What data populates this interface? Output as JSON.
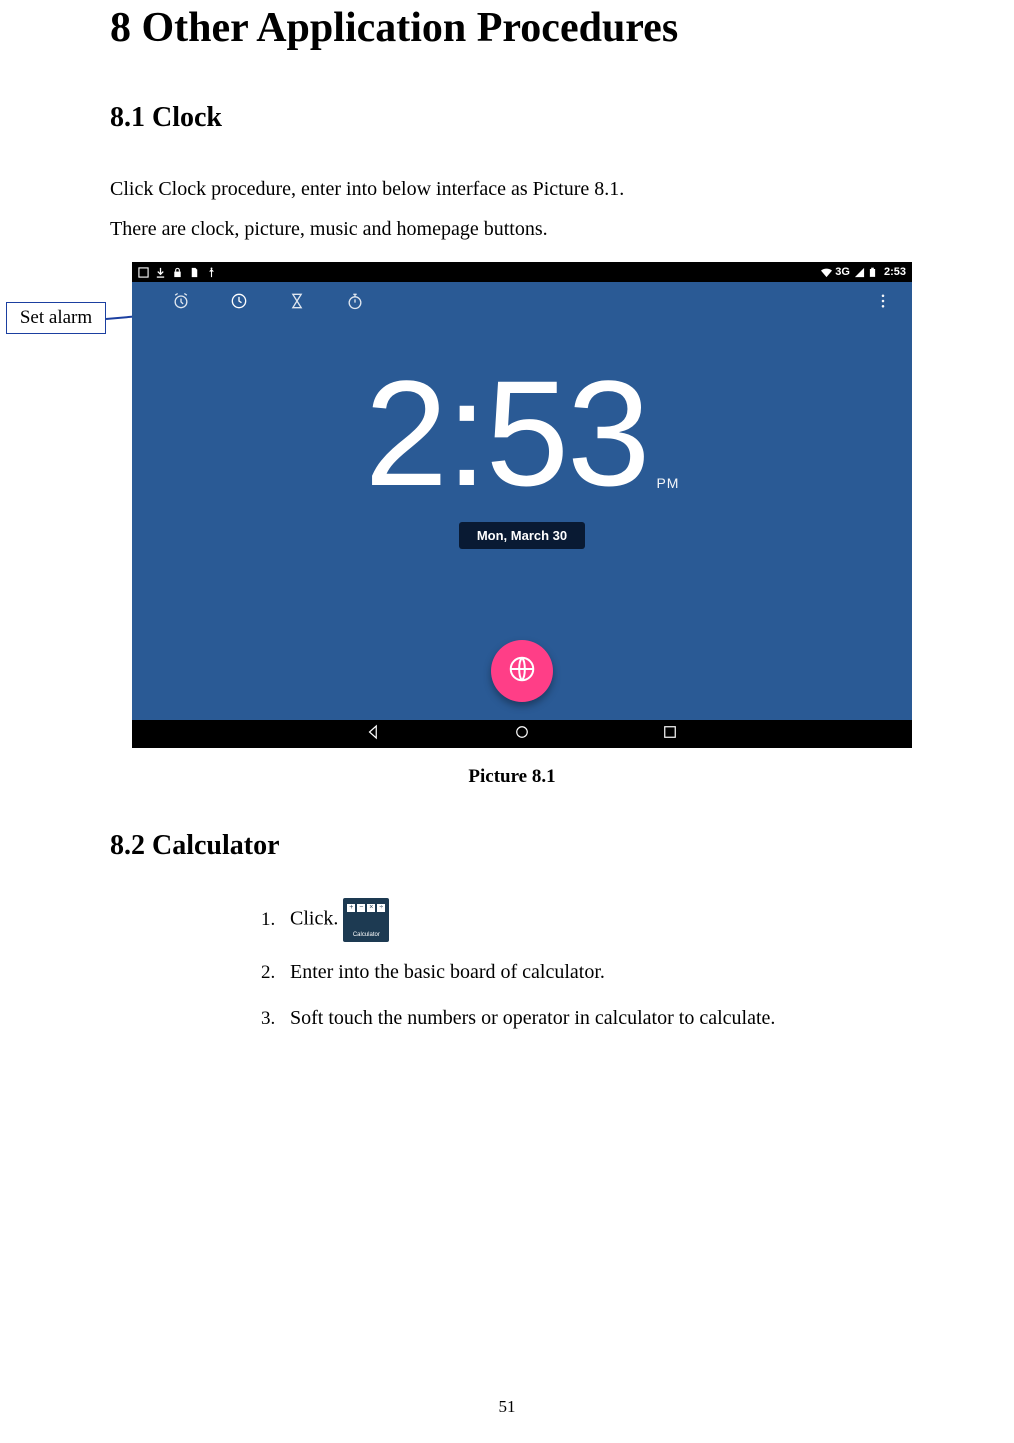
{
  "chapter_title": "8 Other Application Procedures",
  "section1": {
    "title": "8.1 Clock",
    "para1": "Click Clock procedure, enter into below interface as Picture 8.1.",
    "para2": "There are clock, picture, music and homepage buttons."
  },
  "callout_label": "Set alarm",
  "screenshot": {
    "statusbar": {
      "network_label": "3G",
      "time": "2:53"
    },
    "tabs": {
      "alarm_icon": "alarm",
      "clock_icon": "clock",
      "timer_icon": "hourglass",
      "stopwatch_icon": "stopwatch",
      "menu_icon": "more-vert"
    },
    "clock": {
      "time": "2:53",
      "ampm": "PM",
      "date": "Mon, March 30"
    },
    "fab_icon": "globe",
    "nav": {
      "back": "back",
      "home": "home",
      "recent": "recent"
    }
  },
  "caption": "Picture 8.1",
  "section2": {
    "title": "8.2 Calculator",
    "steps": [
      "Click.",
      "Enter into the basic board of calculator.",
      "Soft touch the numbers or operator in calculator to calculate."
    ],
    "calc_icon_label": "Calculator"
  },
  "page_number": "51"
}
